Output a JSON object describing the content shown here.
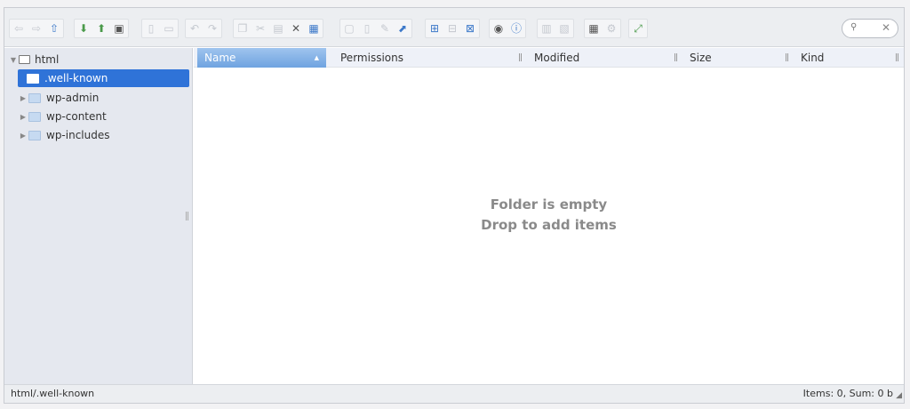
{
  "toolbar": {
    "groups": [
      {
        "buttons": [
          {
            "name": "back-icon",
            "glyph": "⇦",
            "tone": "dim"
          },
          {
            "name": "forward-icon",
            "glyph": "⇨",
            "tone": "dim"
          },
          {
            "name": "up-icon",
            "glyph": "⇧",
            "tone": "blue"
          }
        ]
      },
      {
        "buttons": [
          {
            "name": "download-icon",
            "glyph": "⬇",
            "tone": "green"
          },
          {
            "name": "upload-icon",
            "glyph": "⬆",
            "tone": "green"
          },
          {
            "name": "save-icon",
            "glyph": "▣",
            "tone": "dark"
          }
        ]
      },
      {
        "buttons": [
          {
            "name": "open-icon",
            "glyph": "▯",
            "tone": "dim"
          },
          {
            "name": "save-disabled-icon",
            "glyph": "▭",
            "tone": "dim"
          }
        ]
      },
      {
        "buttons": [
          {
            "name": "undo-icon",
            "glyph": "↶",
            "tone": "dim"
          },
          {
            "name": "redo-icon",
            "glyph": "↷",
            "tone": "dim"
          }
        ]
      },
      {
        "buttons": [
          {
            "name": "copy-icon",
            "glyph": "❐",
            "tone": "dim"
          },
          {
            "name": "cut-icon",
            "glyph": "✂",
            "tone": "dim"
          },
          {
            "name": "paste-icon",
            "glyph": "▤",
            "tone": "dim"
          },
          {
            "name": "delete-icon",
            "glyph": "✕",
            "tone": "dark"
          },
          {
            "name": "trash-icon",
            "glyph": "▦",
            "tone": "blue"
          }
        ]
      },
      {
        "buttons": [
          {
            "name": "duplicate-icon",
            "glyph": "▢",
            "tone": "dim"
          },
          {
            "name": "rename-icon",
            "glyph": "▯",
            "tone": "dim"
          },
          {
            "name": "edit-icon",
            "glyph": "✎",
            "tone": "dim"
          },
          {
            "name": "resize-icon",
            "glyph": "⬈",
            "tone": "blue"
          }
        ]
      },
      {
        "buttons": [
          {
            "name": "icons-view-icon",
            "glyph": "⊞",
            "tone": "blue"
          },
          {
            "name": "list-view-icon",
            "glyph": "⊟",
            "tone": "dim"
          },
          {
            "name": "details-view-icon",
            "glyph": "⊠",
            "tone": "blue"
          }
        ]
      },
      {
        "buttons": [
          {
            "name": "preview-icon",
            "glyph": "◉",
            "tone": "dark"
          },
          {
            "name": "info-icon",
            "glyph": "ⓘ",
            "tone": "blue"
          }
        ]
      },
      {
        "buttons": [
          {
            "name": "extract-icon",
            "glyph": "▥",
            "tone": "dim"
          },
          {
            "name": "archive-icon",
            "glyph": "▧",
            "tone": "dim"
          }
        ]
      },
      {
        "buttons": [
          {
            "name": "select-all-icon",
            "glyph": "▦",
            "tone": "dark"
          },
          {
            "name": "settings-icon",
            "glyph": "⚙",
            "tone": "dim"
          }
        ]
      },
      {
        "buttons": [
          {
            "name": "fullscreen-icon",
            "glyph": "⤢",
            "tone": "green"
          }
        ]
      }
    ]
  },
  "search": {
    "value": "",
    "placeholder": ""
  },
  "tree": {
    "root": {
      "label": "html"
    },
    "items": [
      {
        "label": ".well-known",
        "selected": true
      },
      {
        "label": "wp-admin"
      },
      {
        "label": "wp-content"
      },
      {
        "label": "wp-includes"
      }
    ]
  },
  "columns": [
    "Name",
    "Permissions",
    "Modified",
    "Size",
    "Kind"
  ],
  "empty": {
    "line1": "Folder is empty",
    "line2": "Drop to add items"
  },
  "status": {
    "path": "html/.well-known",
    "info": "Items: 0, Sum: 0 b"
  }
}
